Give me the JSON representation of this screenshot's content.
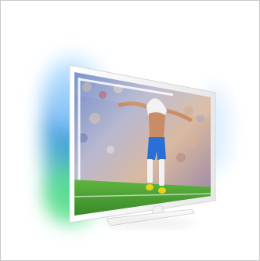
{
  "image": {
    "subject": "tv-product-photo",
    "ambilight_colors": {
      "left_top": "#8fd0ff",
      "left_mid": "#2f8fe0",
      "left_bottom": "#58e08a",
      "right": "#d8ecff"
    },
    "bezel_color": "#f4f4f4",
    "screen_scene": {
      "grass": "#3f9a2f",
      "shorts": "#2a6fd6",
      "shirt": "#f2f2f2",
      "skin": "#c98c64",
      "boots": "#e8d21a"
    }
  }
}
